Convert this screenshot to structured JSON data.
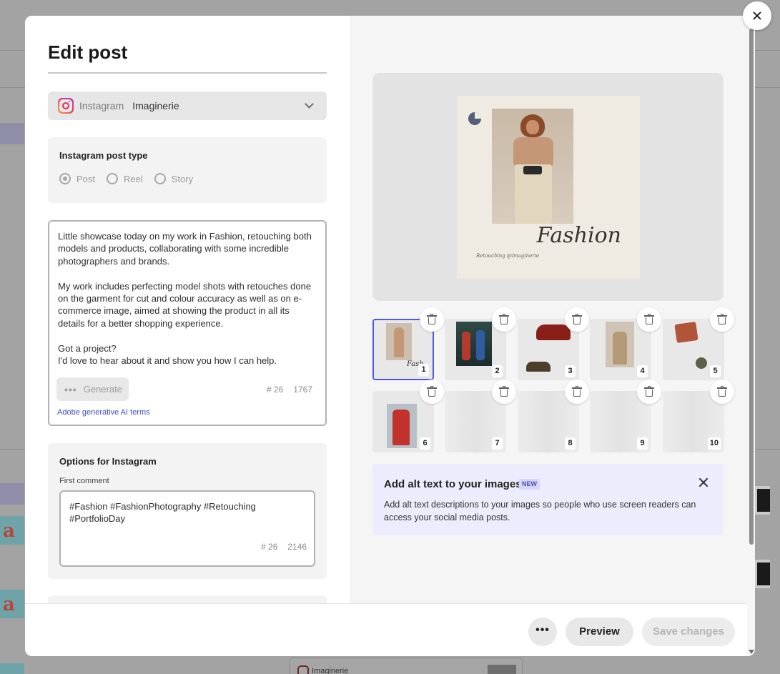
{
  "dialog": {
    "title": "Edit post",
    "account": {
      "platform": "Instagram",
      "name": "Imaginerie"
    },
    "post_type": {
      "title": "Instagram post type",
      "options": [
        "Post",
        "Reel",
        "Story"
      ],
      "selected": "Post"
    },
    "caption": {
      "text": "Little showcase today on my work in Fashion, retouching both models and products, collaborating with some incredible photographers and brands.\n\nMy work includes perfecting model shots with retouches done on the garment for cut and colour accuracy as well as on e-commerce image, aimed at showing the product in all its details for a better shopping experience.\n\nGot a project?\nI'd love to hear about it and show you how I can help.",
      "generate_label": "Generate",
      "hashtag_count": "# 26",
      "char_count": "1767",
      "ai_terms_link": "Adobe generative AI terms"
    },
    "options": {
      "title": "Options for Instagram",
      "first_comment_label": "First comment",
      "first_comment": "#Fashion #FashionPhotography #Retouching #PortfolioDay",
      "hashtag_count": "# 26",
      "char_count": "2146"
    },
    "preview": {
      "headline": "Fashion",
      "credit": "Retouching @imaginerie"
    },
    "thumbnails": [
      "1",
      "2",
      "3",
      "4",
      "5",
      "6",
      "7",
      "8",
      "9",
      "10"
    ],
    "alt_banner": {
      "title": "Add alt text to your images",
      "badge": "NEW",
      "body": "Add alt text descriptions to your images so people who use screen readers can access your social media posts."
    },
    "footer": {
      "more_label": "•••",
      "preview_label": "Preview",
      "save_label": "Save changes"
    }
  },
  "background": {
    "card_label": "Imaginerie"
  },
  "colors": {
    "accent": "#5258e4",
    "link": "#3a4dc9",
    "banner_bg": "#ececfc",
    "overlay": "#a3a3a3"
  }
}
